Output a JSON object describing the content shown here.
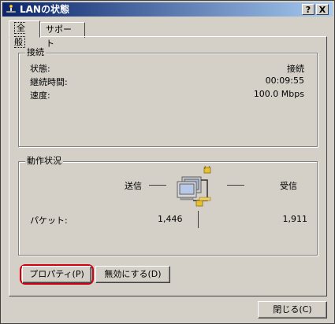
{
  "window": {
    "title": "LANの状態",
    "help_label": "?",
    "close_label": "X"
  },
  "tabs": [
    {
      "label": "全般",
      "active": true
    },
    {
      "label": "サポート",
      "active": false
    }
  ],
  "connection": {
    "legend": "接続",
    "rows": [
      {
        "label": "状態:",
        "value": "接続"
      },
      {
        "label": "継続時間:",
        "value": "00:09:55"
      },
      {
        "label": "速度:",
        "value": "100.0 Mbps"
      }
    ]
  },
  "activity": {
    "legend": "動作状況",
    "sent_label": "送信",
    "received_label": "受信",
    "packets_label": "パケット:",
    "packets_sent": "1,446",
    "packets_received": "1,911"
  },
  "buttons": {
    "properties": "プロパティ(P)",
    "disable": "無効にする(D)",
    "close": "閉じる(C)"
  },
  "colors": {
    "titlebar_start": "#0a246a",
    "titlebar_end": "#a6caf0",
    "highlight_ring": "#d00010"
  }
}
